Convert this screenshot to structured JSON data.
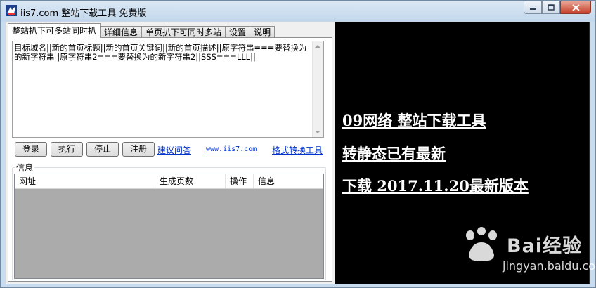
{
  "window": {
    "title": "iis7.com 整站下载工具 免费版"
  },
  "tabs": [
    {
      "label": "整站扒下可多站同时扒"
    },
    {
      "label": "详细信息"
    },
    {
      "label": "单页扒下可同时多站"
    },
    {
      "label": "设置"
    },
    {
      "label": "说明"
    }
  ],
  "input": {
    "text": "目标域名||新的首页标题||新的首页关键词||新的首页描述||原字符串===要替换为的新字符串||原字符串2===要替换为的新字符串2||SSS===LLL||"
  },
  "buttons": {
    "login": "登录",
    "execute": "执行",
    "stop": "停止",
    "register": "注册"
  },
  "links": {
    "feedback": "建议问答",
    "site": "www.iis7.com",
    "convert": "格式转换工具"
  },
  "info_group": {
    "label": "信息",
    "columns": [
      "网址",
      "生成页数",
      "操作",
      "信息"
    ]
  },
  "banner": {
    "line1": "09网络 整站下载工具",
    "line2": "转静态已有最新",
    "line3": "下载 2017.11.20最新版本"
  },
  "watermark": {
    "brand": "Bai经验",
    "url": "jingyan.baidu.com"
  }
}
